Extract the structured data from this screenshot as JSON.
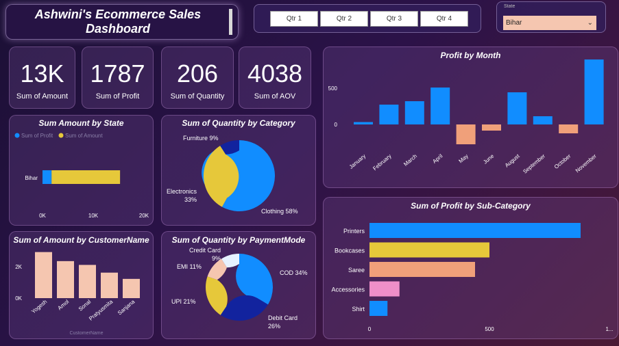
{
  "header": {
    "title_line1": "Ashwini's  Ecommerce Sales",
    "title_line2": "Dashboard"
  },
  "quarter_slicer": [
    "Qtr 1",
    "Qtr 2",
    "Qtr 3",
    "Qtr 4"
  ],
  "state_filter": {
    "label": "State",
    "selected": "Bihar"
  },
  "kpis": [
    {
      "value": "13K",
      "label": "Sum of Amount"
    },
    {
      "value": "1787",
      "label": "Sum of Profit"
    },
    {
      "value": "206",
      "label": "Sum of Quantity"
    },
    {
      "value": "4038",
      "label": "Sum of AOV"
    }
  ],
  "colors": {
    "blue": "#118dff",
    "yellow": "#e6c83a",
    "salmon": "#f0a07a",
    "peach": "#f5c6b0",
    "navy": "#12239e",
    "pink": "#ef8fc8",
    "lightblue": "#e6f2ff"
  },
  "chart_data": [
    {
      "type": "bar",
      "orientation": "horizontal",
      "stacked": true,
      "title": "Sum Amount by State",
      "categories": [
        "Bihar"
      ],
      "series": [
        {
          "name": "Sum of Profit",
          "values": [
            1787
          ]
        },
        {
          "name": "Sum of Amount",
          "values": [
            13500
          ]
        }
      ],
      "xticks": [
        "0K",
        "10K",
        "20K"
      ],
      "xlim": [
        0,
        20000
      ],
      "legend": "top-left"
    },
    {
      "type": "pie",
      "donut": true,
      "title": "Sum of Quantity by Category",
      "labels": [
        "Clothing",
        "Electronics",
        "Furniture"
      ],
      "values": [
        58,
        33,
        9
      ],
      "label_text": [
        "Clothing 58%",
        "Electronics\n33%",
        "Furniture 9%"
      ]
    },
    {
      "type": "bar",
      "title": "Sum of Amount by CustomerName",
      "categories": [
        "Yogesh",
        "Amol",
        "Sonal",
        "Pratyusmita",
        "Sanjana"
      ],
      "values": [
        2800,
        2250,
        2020,
        1550,
        1170
      ],
      "yticks": [
        "0K",
        "2K"
      ],
      "ylim": [
        0,
        3200
      ],
      "xlabel": "CustomerName"
    },
    {
      "type": "pie",
      "donut": true,
      "title": "Sum of Quantity by PaymentMode",
      "labels": [
        "COD",
        "Debit Card",
        "UPI",
        "EMI",
        "Credit Card"
      ],
      "values": [
        34,
        26,
        21,
        11,
        9
      ],
      "label_text": [
        "COD 34%",
        "Debit Card\n26%",
        "UPI 21%",
        "EMI 11%",
        "Credit Card\n9%"
      ]
    },
    {
      "type": "bar",
      "title": "Profit by Month",
      "categories": [
        "January",
        "February",
        "March",
        "April",
        "May",
        "June",
        "August",
        "September",
        "October",
        "November"
      ],
      "values": [
        35,
        290,
        340,
        540,
        -290,
        -90,
        470,
        120,
        -130,
        950
      ],
      "yticks": [
        "0",
        "500"
      ],
      "ylim": [
        -400,
        1000
      ]
    },
    {
      "type": "bar",
      "orientation": "horizontal",
      "title": "Sum of Profit by Sub-Category",
      "categories": [
        "Printers",
        "Bookcases",
        "Saree",
        "Accessories",
        "Shirt"
      ],
      "values": [
        880,
        500,
        440,
        125,
        75
      ],
      "xticks": [
        "0",
        "500",
        "1..."
      ],
      "xlim": [
        0,
        1000
      ]
    }
  ]
}
